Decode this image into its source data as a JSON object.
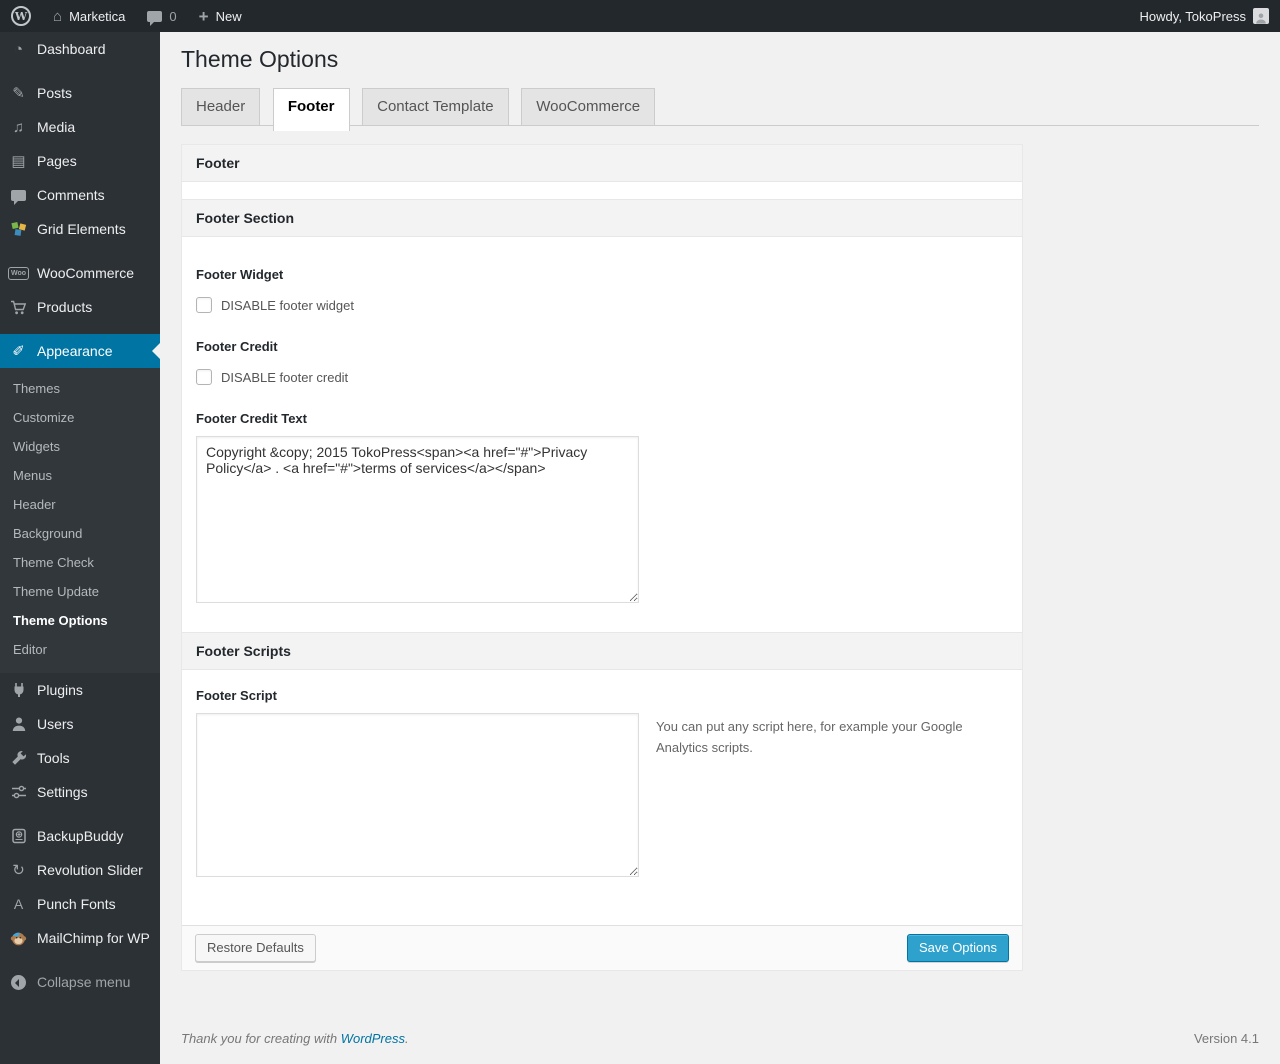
{
  "colors": {
    "accent": "#0074a2",
    "primary_button": "#2ea2cc",
    "link": "#0074a2",
    "adminbar_bg": "#23282d",
    "menu_bg": "#2c3136",
    "submenu_bg": "#32373c"
  },
  "admin_bar": {
    "wp_logo_glyph": "W",
    "home_glyph": "⌂",
    "site_name": "Marketica",
    "comment_count": "0",
    "plus_glyph": "+",
    "new_label": "New",
    "howdy_text": "Howdy, TokoPress"
  },
  "sidebar": {
    "menu": [
      {
        "label": "Dashboard",
        "glyph": "◔"
      },
      {
        "label": "Posts",
        "glyph": "✎"
      },
      {
        "label": "Media",
        "glyph": "♫"
      },
      {
        "label": "Pages",
        "glyph": "▤"
      },
      {
        "label": "Comments",
        "glyph": ""
      },
      {
        "label": "Grid Elements",
        "glyph": ""
      },
      {
        "label": "WooCommerce",
        "badge": "Woo"
      },
      {
        "label": "Products",
        "glyph": ""
      },
      {
        "label": "Appearance",
        "glyph": "✐",
        "active": true
      },
      {
        "label": "Plugins",
        "glyph": ""
      },
      {
        "label": "Users",
        "glyph": ""
      },
      {
        "label": "Tools",
        "glyph": ""
      },
      {
        "label": "Settings",
        "glyph": ""
      },
      {
        "label": "BackupBuddy",
        "glyph": ""
      },
      {
        "label": "Revolution Slider",
        "glyph": "↻"
      },
      {
        "label": "Punch Fonts",
        "glyph": "A"
      },
      {
        "label": "MailChimp for WP",
        "glyph": ""
      }
    ],
    "appearance_submenu": [
      {
        "label": "Themes"
      },
      {
        "label": "Customize"
      },
      {
        "label": "Widgets"
      },
      {
        "label": "Menus"
      },
      {
        "label": "Header"
      },
      {
        "label": "Background"
      },
      {
        "label": "Theme Check"
      },
      {
        "label": "Theme Update"
      },
      {
        "label": "Theme Options",
        "current": true
      },
      {
        "label": "Editor"
      }
    ],
    "collapse_label": "Collapse menu"
  },
  "main": {
    "page_title": "Theme Options",
    "tabs": [
      {
        "label": "Header",
        "active": false
      },
      {
        "label": "Footer",
        "active": true
      },
      {
        "label": "Contact Template",
        "active": false
      },
      {
        "label": "WooCommerce",
        "active": false
      }
    ],
    "panel_title": "Footer",
    "footer_section": {
      "title": "Footer Section",
      "footer_widget_label": "Footer Widget",
      "footer_widget_checkbox_label": "DISABLE footer widget",
      "footer_widget_checked": false,
      "footer_credit_label": "Footer Credit",
      "footer_credit_checkbox_label": "DISABLE footer credit",
      "footer_credit_checked": false,
      "footer_credit_text_label": "Footer Credit Text",
      "footer_credit_text_value": "Copyright &copy; 2015 TokoPress<span><a href=\"#\">Privacy Policy</a> . <a href=\"#\">terms of services</a></span>"
    },
    "footer_scripts": {
      "title": "Footer Scripts",
      "footer_script_label": "Footer Script",
      "footer_script_value": "",
      "footer_script_help": "You can put any script here, for example your Google Analytics scripts."
    },
    "buttons": {
      "restore": "Restore Defaults",
      "save": "Save Options"
    }
  },
  "page_footer": {
    "thankyou_prefix": "Thank you for creating with ",
    "wordpress_link": "WordPress",
    "thankyou_suffix": ".",
    "version": "Version 4.1"
  }
}
